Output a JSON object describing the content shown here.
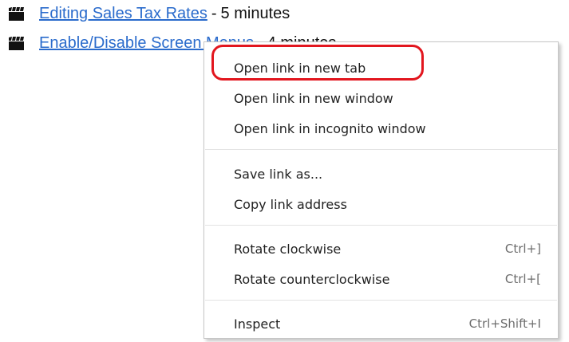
{
  "videos": [
    {
      "title": "Editing Sales Tax Rates",
      "separator": "-",
      "duration": "5 minutes",
      "icon": "clapperboard-icon"
    },
    {
      "title": "Enable/Disable Screen Menus",
      "separator": "-",
      "duration": "4 minutes",
      "icon": "clapperboard-icon"
    }
  ],
  "context_menu": {
    "items": [
      {
        "label": "Open link in new tab",
        "shortcut": ""
      },
      {
        "label": "Open link in new window",
        "shortcut": ""
      },
      {
        "label": "Open link in incognito window",
        "shortcut": ""
      },
      {
        "label": "Save link as...",
        "shortcut": ""
      },
      {
        "label": "Copy link address",
        "shortcut": ""
      },
      {
        "label": "Rotate clockwise",
        "shortcut": "Ctrl+]"
      },
      {
        "label": "Rotate counterclockwise",
        "shortcut": "Ctrl+["
      },
      {
        "label": "Inspect",
        "shortcut": "Ctrl+Shift+I"
      }
    ]
  },
  "annotation": {
    "highlight_color": "#e2161e",
    "highlighted_item": "Open link in new tab"
  },
  "colors": {
    "link": "#2a6bcc",
    "menu_text": "#222222",
    "shortcut_text": "#6d6d6d"
  }
}
